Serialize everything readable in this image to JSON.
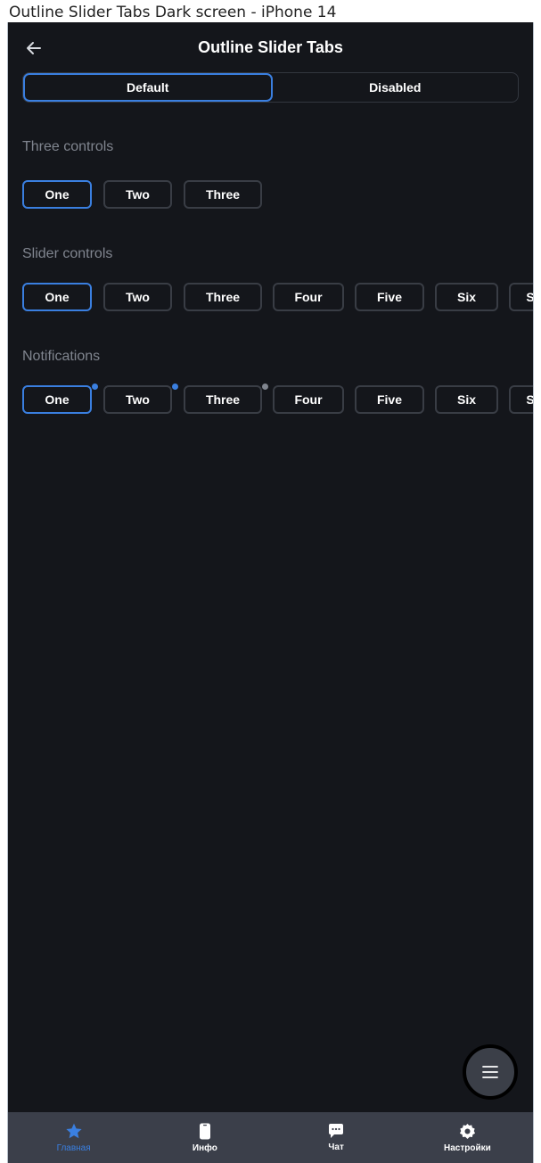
{
  "caption": "Outline Slider Tabs Dark screen - iPhone 14",
  "header": {
    "title": "Outline Slider Tabs"
  },
  "segmented": {
    "default_label": "Default",
    "disabled_label": "Disabled"
  },
  "sections": {
    "three": {
      "title": "Three controls",
      "tabs": [
        "One",
        "Two",
        "Three"
      ]
    },
    "slider": {
      "title": "Slider controls",
      "tabs": [
        "One",
        "Two",
        "Three",
        "Four",
        "Five",
        "Six",
        "Seven"
      ]
    },
    "notifications": {
      "title": "Notifications",
      "tabs": [
        "One",
        "Two",
        "Three",
        "Four",
        "Five",
        "Six",
        "Seven"
      ]
    }
  },
  "nav": {
    "home": "Главная",
    "info": "Инфо",
    "chat": "Чат",
    "settings": "Настройки"
  },
  "colors": {
    "accent": "#3a7fe0",
    "background": "#14161b",
    "nav_bg": "#3b3f4a",
    "muted": "#80858f"
  }
}
